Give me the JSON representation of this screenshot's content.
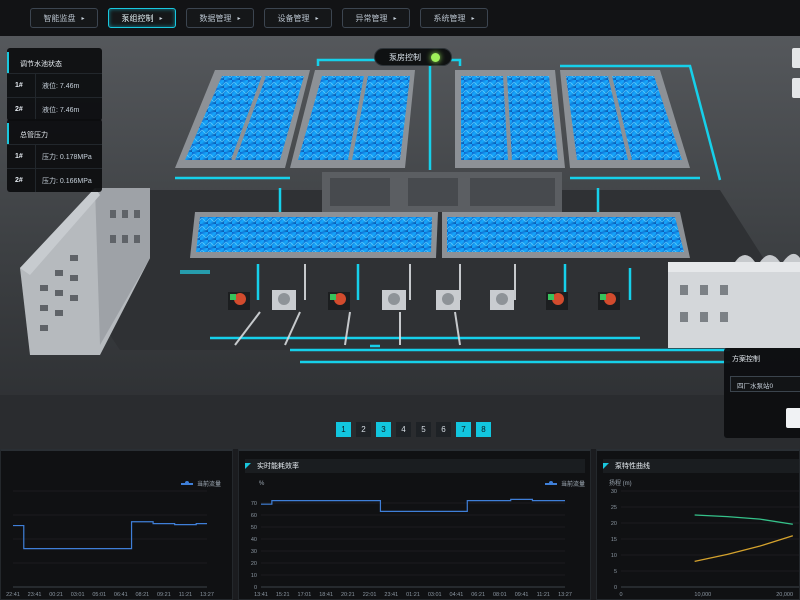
{
  "nav": {
    "tabs": [
      {
        "label": "智能监盘",
        "active": false
      },
      {
        "label": "泵组控制",
        "active": true
      },
      {
        "label": "数据管理",
        "active": false
      },
      {
        "label": "设备管理",
        "active": false
      },
      {
        "label": "异常管理",
        "active": false
      },
      {
        "label": "系统管理",
        "active": false
      }
    ]
  },
  "status_pill": {
    "label": "泵房控制",
    "indicator_color": "#9ff05a"
  },
  "water_level_card": {
    "title": "调节水池状态",
    "rows": [
      {
        "idx": "1#",
        "value": "液位: 7.46m"
      },
      {
        "idx": "2#",
        "value": "液位: 7.46m"
      }
    ]
  },
  "pressure_card": {
    "title": "总管压力",
    "rows": [
      {
        "idx": "1#",
        "value": "压力: 0.178MPa"
      },
      {
        "idx": "2#",
        "value": "压力: 0.166MPa"
      }
    ]
  },
  "plant_panel": {
    "title": "方案控制",
    "select_value": "四厂水泵站0"
  },
  "pager": {
    "pages": [
      {
        "label": "1",
        "active": true
      },
      {
        "label": "2",
        "active": false
      },
      {
        "label": "3",
        "active": true
      },
      {
        "label": "4",
        "active": false
      },
      {
        "label": "5",
        "active": false
      },
      {
        "label": "6",
        "active": false
      },
      {
        "label": "7",
        "active": true
      },
      {
        "label": "8",
        "active": true
      }
    ]
  },
  "charts": {
    "left": {
      "title": "",
      "legend": "当前流量"
    },
    "middle": {
      "title": "实时能耗效率",
      "legend": "当前流量"
    },
    "right": {
      "title": "泵特性曲线"
    }
  },
  "chart_data": [
    {
      "type": "line",
      "title": "",
      "xlabel": "",
      "ylabel": "",
      "x": [
        "22:41",
        "23:41",
        "00:21",
        "03:01",
        "05:01",
        "06:41",
        "08:21",
        "09:21",
        "11:21",
        "13:27"
      ],
      "series": [
        {
          "name": "当前流量",
          "values": [
            64,
            40,
            40,
            40,
            40,
            40,
            68,
            66,
            65,
            66
          ]
        }
      ],
      "ylim": [
        0,
        100
      ],
      "grid": true,
      "legend": "top-right"
    },
    {
      "type": "line",
      "title": "实时能耗效率",
      "xlabel": "",
      "ylabel": "%",
      "x": [
        "13:41",
        "15:21",
        "17:01",
        "18:41",
        "20:21",
        "22:01",
        "23:41",
        "01:21",
        "03:01",
        "04:41",
        "06:21",
        "08:01",
        "09:41",
        "11:21",
        "13:27"
      ],
      "yticks": [
        0,
        10,
        20,
        30,
        40,
        50,
        60,
        70
      ],
      "series": [
        {
          "name": "当前流量",
          "values": [
            69,
            72,
            72,
            72,
            72,
            72,
            63,
            63,
            63,
            63,
            72,
            72,
            73,
            72,
            72
          ]
        }
      ],
      "ylim": [
        0,
        80
      ],
      "grid": true,
      "legend": "top-right"
    },
    {
      "type": "line",
      "title": "泵特性曲线",
      "xlabel": "",
      "ylabel": "扬程 (m)",
      "x_ticks": [
        "0",
        "10,000",
        "20,000"
      ],
      "yticks": [
        0,
        5,
        10,
        15,
        20,
        25,
        30
      ],
      "series": [
        {
          "name": "",
          "color": "#35c28a",
          "points": [
            [
              9000,
              22.5
            ],
            [
              13000,
              22.0
            ],
            [
              17000,
              21.2
            ],
            [
              21000,
              19.6
            ]
          ]
        },
        {
          "name": "",
          "color": "#d4a22d",
          "points": [
            [
              9000,
              8.0
            ],
            [
              13000,
              10.2
            ],
            [
              17000,
              12.8
            ],
            [
              21000,
              16.0
            ]
          ]
        }
      ],
      "xlim": [
        0,
        22000
      ],
      "ylim": [
        0,
        30
      ],
      "grid": true
    }
  ]
}
